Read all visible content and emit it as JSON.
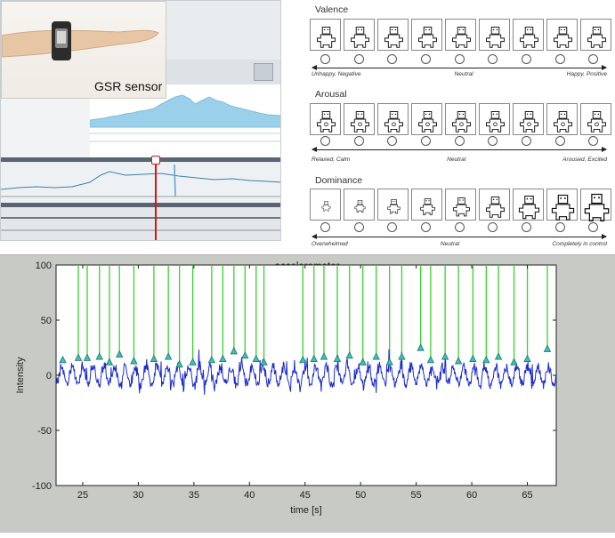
{
  "gsr_panel": {
    "photo_caption": "GSR sensor"
  },
  "sam": {
    "valence": {
      "title": "Valence",
      "left_label": "Unhappy, Negative",
      "middle_label": "Neutral",
      "right_label": "Happy, Positive",
      "count": 9
    },
    "arousal": {
      "title": "Arousal",
      "left_label": "Relaxed, Calm",
      "middle_label": "Neutral",
      "right_label": "Aroused, Excited",
      "count": 9
    },
    "dominance": {
      "title": "Dominance",
      "left_label": "Overwhelmed",
      "middle_label": "Neutral",
      "right_label": "Completely in control",
      "count": 9
    }
  },
  "colors": {
    "gsr_signal": "#9ad0ea",
    "cursor": "#d11919",
    "acc_signal": "#1d2ccf",
    "peak_lines": "#39d12e",
    "peak_markers": "#39c4b8"
  },
  "chart_data": {
    "type": "line",
    "title": "accelerometer",
    "xlabel": "time [s]",
    "ylabel": "Intensity",
    "xlim": [
      22.6,
      67.6
    ],
    "ylim": [
      -100,
      100
    ],
    "xticks": [
      25,
      30,
      35,
      40,
      45,
      50,
      55,
      60,
      65
    ],
    "yticks": [
      100,
      50,
      0,
      -50,
      -100
    ],
    "grid": false,
    "series": [
      {
        "type": "line",
        "seed": 7,
        "sample_rate": 20,
        "baseline": 0,
        "amplitude": 9
      }
    ],
    "peaks": [
      {
        "x": 23.2,
        "y": 14,
        "line": false
      },
      {
        "x": 24.6,
        "y": 16,
        "line": true
      },
      {
        "x": 25.4,
        "y": 16,
        "line": true
      },
      {
        "x": 26.5,
        "y": 17,
        "line": true
      },
      {
        "x": 27.4,
        "y": 12,
        "line": true
      },
      {
        "x": 28.3,
        "y": 19,
        "line": true
      },
      {
        "x": 29.6,
        "y": 13,
        "line": true
      },
      {
        "x": 31.4,
        "y": 15,
        "line": true
      },
      {
        "x": 32.7,
        "y": 17,
        "line": true
      },
      {
        "x": 33.7,
        "y": 10,
        "line": true
      },
      {
        "x": 34.9,
        "y": 12,
        "line": true
      },
      {
        "x": 36.6,
        "y": 14,
        "line": true
      },
      {
        "x": 37.6,
        "y": 15,
        "line": true
      },
      {
        "x": 38.6,
        "y": 22,
        "line": true
      },
      {
        "x": 39.6,
        "y": 18,
        "line": true
      },
      {
        "x": 40.6,
        "y": 15,
        "line": true
      },
      {
        "x": 41.3,
        "y": 12,
        "line": true
      },
      {
        "x": 44.8,
        "y": 14,
        "line": true
      },
      {
        "x": 45.8,
        "y": 15,
        "line": true
      },
      {
        "x": 46.7,
        "y": 17,
        "line": true
      },
      {
        "x": 47.9,
        "y": 15,
        "line": true
      },
      {
        "x": 49.0,
        "y": 18,
        "line": true
      },
      {
        "x": 50.2,
        "y": 12,
        "line": true
      },
      {
        "x": 51.4,
        "y": 17,
        "line": true
      },
      {
        "x": 52.6,
        "y": 12,
        "line": true
      },
      {
        "x": 53.7,
        "y": 17,
        "line": true
      },
      {
        "x": 55.4,
        "y": 25,
        "line": true
      },
      {
        "x": 56.3,
        "y": 14,
        "line": true
      },
      {
        "x": 57.6,
        "y": 17,
        "line": true
      },
      {
        "x": 58.8,
        "y": 13,
        "line": true
      },
      {
        "x": 60.1,
        "y": 15,
        "line": true
      },
      {
        "x": 61.3,
        "y": 14,
        "line": true
      },
      {
        "x": 62.4,
        "y": 17,
        "line": true
      },
      {
        "x": 63.8,
        "y": 12,
        "line": true
      },
      {
        "x": 65.0,
        "y": 15,
        "line": true
      },
      {
        "x": 66.8,
        "y": 24,
        "line": true
      }
    ]
  }
}
